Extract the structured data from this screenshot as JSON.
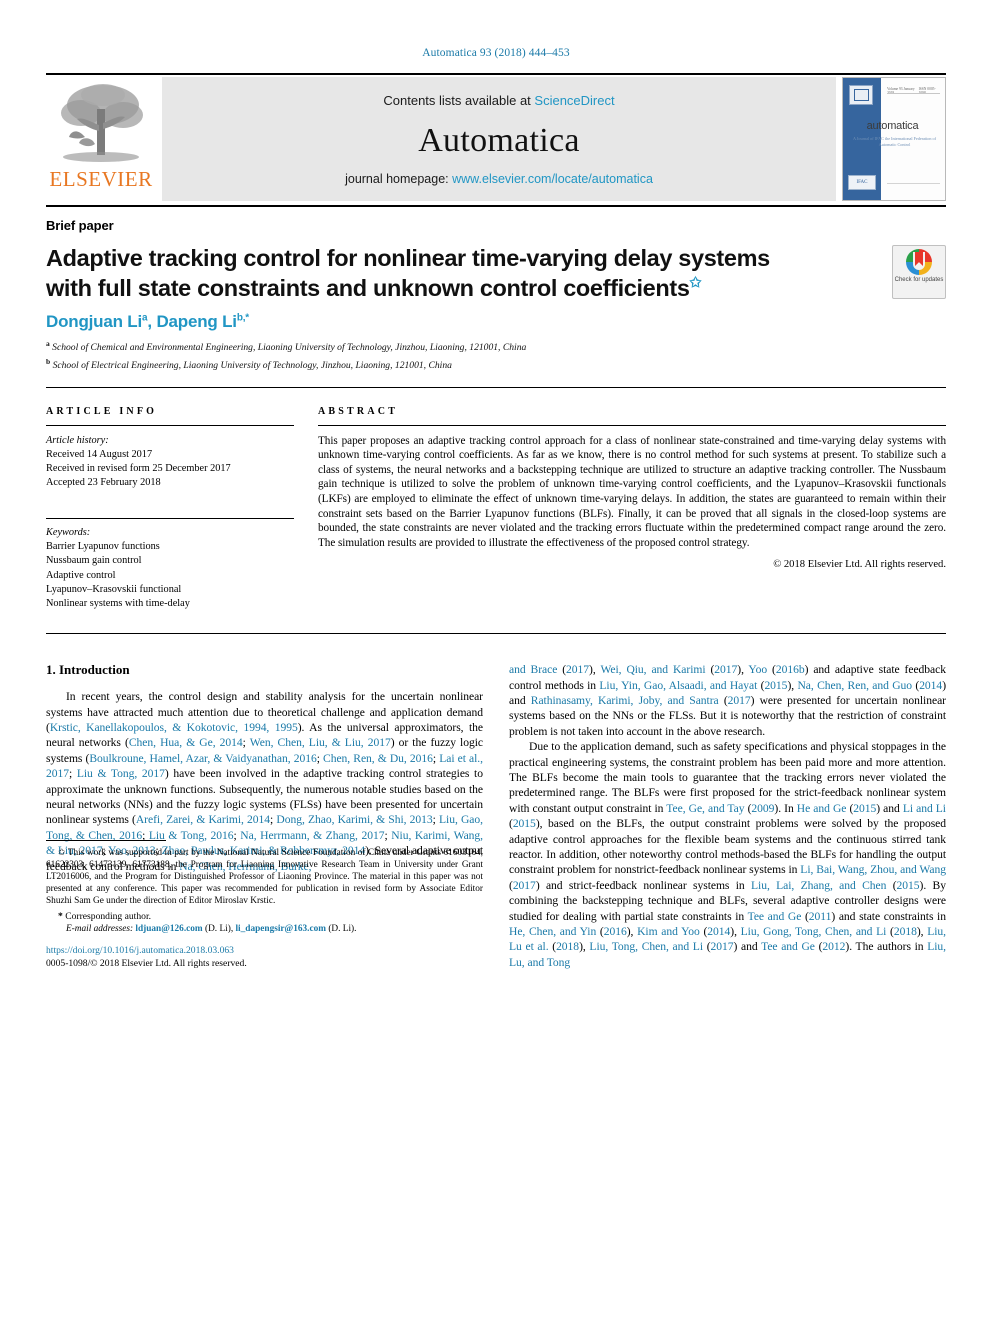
{
  "running_head": "Automatica 93 (2018) 444–453",
  "banner": {
    "contents_prefix": "Contents lists available at ",
    "contents_link": "ScienceDirect",
    "journal_name": "Automatica",
    "homepage_prefix": "journal homepage: ",
    "homepage_link": "www.elsevier.com/locate/automatica",
    "publisher": "ELSEVIER",
    "cover": {
      "title": "automatica",
      "subtitle": "A Journal of IFAC the International Federation of Automatic Control",
      "top_left": "Volume 93   January 2018",
      "top_right": "ISSN 0005-1098",
      "badge": "IFAC"
    }
  },
  "article": {
    "type": "Brief paper",
    "title_line1": "Adaptive tracking control for nonlinear time-varying delay systems",
    "title_line2": "with full state constraints and unknown control coefficients",
    "title_footnote_marker": "✩",
    "authors": "Dongjuan Li",
    "author_sup_a": "a",
    "author2": "Dapeng Li",
    "author_sup_b": "b,*",
    "affiliation_a_marker": "a",
    "affiliation_a": "School of Chemical and Environmental Engineering, Liaoning University of Technology, Jinzhou, Liaoning, 121001, China",
    "affiliation_b_marker": "b",
    "affiliation_b": "School of Electrical Engineering, Liaoning University of Technology, Jinzhou, Liaoning, 121001, China",
    "crossmark_label": "Check for updates"
  },
  "info": {
    "heading": "ARTICLE INFO",
    "history_label": "Article history:",
    "history": [
      "Received 14 August 2017",
      "Received in revised form 25 December 2017",
      "Accepted 23 February 2018"
    ],
    "keywords_label": "Keywords:",
    "keywords": [
      "Barrier Lyapunov functions",
      "Nussbaum gain control",
      "Adaptive control",
      "Lyapunov–Krasovskii functional",
      "Nonlinear systems with time-delay"
    ]
  },
  "abstract": {
    "heading": "ABSTRACT",
    "text": "This paper proposes an adaptive tracking control approach for a class of nonlinear state-constrained and time-varying delay systems with unknown time-varying control coefficients. As far as we know, there is no control method for such systems at present. To stabilize such a class of systems, the neural networks and a backstepping technique are utilized to structure an adaptive tracking controller. The Nussbaum gain technique is utilized to solve the problem of unknown time-varying control coefficients, and the Lyapunov–Krasovskii functionals (LKFs) are employed to eliminate the effect of unknown time-varying delays. In addition, the states are guaranteed to remain within their constraint sets based on the Barrier Lyapunov functions (BLFs). Finally, it can be proved that all signals in the closed-loop systems are bounded, the state constraints are never violated and the tracking errors fluctuate within the predetermined compact range around the zero. The simulation results are provided to illustrate the effectiveness of the proposed control strategy.",
    "copyright": "© 2018 Elsevier Ltd. All rights reserved."
  },
  "introduction": {
    "heading": "1. Introduction",
    "left_paragraph_1_parts": [
      {
        "t": "In recent years, the control design and stability analysis for  the uncertain nonlinear systems have attracted much attention due to theoretical challenge and application demand (",
        "r": false
      },
      {
        "t": "Krstic, Kanellakopoulos, & Kokotovic, 1994, 1995",
        "r": true
      },
      {
        "t": "). As the universal approximators, the neural networks (",
        "r": false
      },
      {
        "t": "Chen, Hua, & Ge, 2014",
        "r": true
      },
      {
        "t": "; ",
        "r": false
      },
      {
        "t": "Wen, Chen, Liu, & Liu, 2017",
        "r": true
      },
      {
        "t": ") or the fuzzy logic systems (",
        "r": false
      },
      {
        "t": "Boulkroune, Hamel, Azar, & Vaidyanathan, 2016",
        "r": true
      },
      {
        "t": "; ",
        "r": false
      },
      {
        "t": "Chen, Ren, & Du, 2016",
        "r": true
      },
      {
        "t": "; ",
        "r": false
      },
      {
        "t": "Lai et al., 2017",
        "r": true
      },
      {
        "t": "; ",
        "r": false
      },
      {
        "t": "Liu & Tong, 2017",
        "r": true
      },
      {
        "t": ") have been involved in the adaptive tracking control strategies to approximate the unknown functions. Subsequently, the numerous notable studies based on the neural networks (NNs) and the fuzzy logic systems (FLSs) have been presented for uncertain nonlinear systems (",
        "r": false
      },
      {
        "t": "Arefi, Zarei, & Karimi, 2014",
        "r": true
      },
      {
        "t": "; ",
        "r": false
      },
      {
        "t": "Dong, Zhao, Karimi, & Shi, 2013",
        "r": true
      },
      {
        "t": "; ",
        "r": false
      },
      {
        "t": "Liu, Gao, Tong, & Chen, 2016",
        "r": true
      },
      {
        "t": "; ",
        "r": false
      },
      {
        "t": "Liu & Tong, 2016",
        "r": true
      },
      {
        "t": "; ",
        "r": false
      },
      {
        "t": "Na, Herrmann, & Zhang, 2017",
        "r": true
      },
      {
        "t": "; ",
        "r": false
      },
      {
        "t": "Niu, Karimi, Wang, & Liu, 2017",
        "r": true
      },
      {
        "t": "; ",
        "r": false
      },
      {
        "t": "Yoo, 2013",
        "r": true
      },
      {
        "t": "; ",
        "r": false
      },
      {
        "t": "Zhao, Pawlus, Karimi, & Robbersmyr, 2014",
        "r": true
      },
      {
        "t": "). Several adaptive output feedback control methods in ",
        "r": false
      },
      {
        "t": "Na, Chen, Herrmann, Burke,",
        "r": true
      }
    ],
    "right_paragraph_1_parts": [
      {
        "t": "and Brace",
        "r": true
      },
      {
        "t": " (",
        "r": false
      },
      {
        "t": "2017",
        "r": true
      },
      {
        "t": "), ",
        "r": false
      },
      {
        "t": "Wei, Qiu, and Karimi",
        "r": true
      },
      {
        "t": " (",
        "r": false
      },
      {
        "t": "2017",
        "r": true
      },
      {
        "t": "), ",
        "r": false
      },
      {
        "t": "Yoo",
        "r": true
      },
      {
        "t": " (",
        "r": false
      },
      {
        "t": "2016b",
        "r": true
      },
      {
        "t": ") and adaptive state feedback control methods in ",
        "r": false
      },
      {
        "t": "Liu, Yin, Gao, Alsaadi, and Hayat",
        "r": true
      },
      {
        "t": " (",
        "r": false
      },
      {
        "t": "2015",
        "r": true
      },
      {
        "t": "), ",
        "r": false
      },
      {
        "t": "Na, Chen, Ren, and Guo",
        "r": true
      },
      {
        "t": " (",
        "r": false
      },
      {
        "t": "2014",
        "r": true
      },
      {
        "t": ") and ",
        "r": false
      },
      {
        "t": "Rathinasamy, Karimi, Joby, and Santra",
        "r": true
      },
      {
        "t": " (",
        "r": false
      },
      {
        "t": "2017",
        "r": true
      },
      {
        "t": ") were presented for uncertain nonlinear systems based on the NNs or the FLSs. But it is noteworthy that the restriction of constraint problem is not taken into account in the above research.",
        "r": false
      }
    ],
    "right_paragraph_2_parts": [
      {
        "t": "Due to the application demand, such as safety specifications and physical stoppages in the practical engineering systems, the constraint problem has been paid more and more attention. The BLFs become the main tools to guarantee that the tracking errors never violated the predetermined range. The BLFs were first proposed for the strict-feedback nonlinear system with constant output constraint in ",
        "r": false
      },
      {
        "t": "Tee, Ge, and Tay",
        "r": true
      },
      {
        "t": " (",
        "r": false
      },
      {
        "t": "2009",
        "r": true
      },
      {
        "t": "). In ",
        "r": false
      },
      {
        "t": "He and Ge",
        "r": true
      },
      {
        "t": " (",
        "r": false
      },
      {
        "t": "2015",
        "r": true
      },
      {
        "t": ") and ",
        "r": false
      },
      {
        "t": "Li and Li",
        "r": true
      },
      {
        "t": " (",
        "r": false
      },
      {
        "t": "2015",
        "r": true
      },
      {
        "t": "), based on the BLFs, the output constraint problems were solved by the proposed adaptive control approaches for the flexible beam systems and the continuous stirred tank reactor. In addition, other noteworthy control methods-based the BLFs for handling the output constraint problem for nonstrict-feedback nonlinear systems in ",
        "r": false
      },
      {
        "t": "Li, Bai, Wang, Zhou, and Wang",
        "r": true
      },
      {
        "t": " (",
        "r": false
      },
      {
        "t": "2017",
        "r": true
      },
      {
        "t": ") and strict-feedback nonlinear systems in ",
        "r": false
      },
      {
        "t": "Liu, Lai, Zhang, and Chen",
        "r": true
      },
      {
        "t": " (",
        "r": false
      },
      {
        "t": "2015",
        "r": true
      },
      {
        "t": "). By combining the backstepping technique and BLFs, several adaptive controller designs were studied for dealing with partial state constraints in ",
        "r": false
      },
      {
        "t": "Tee and Ge",
        "r": true
      },
      {
        "t": " (",
        "r": false
      },
      {
        "t": "2011",
        "r": true
      },
      {
        "t": ") and state constraints in ",
        "r": false
      },
      {
        "t": "He, Chen, and Yin",
        "r": true
      },
      {
        "t": " (",
        "r": false
      },
      {
        "t": "2016",
        "r": true
      },
      {
        "t": "), ",
        "r": false
      },
      {
        "t": "Kim and Yoo",
        "r": true
      },
      {
        "t": " (",
        "r": false
      },
      {
        "t": "2014",
        "r": true
      },
      {
        "t": "), ",
        "r": false
      },
      {
        "t": "Liu, Gong, Tong, Chen, and Li",
        "r": true
      },
      {
        "t": " (",
        "r": false
      },
      {
        "t": "2018",
        "r": true
      },
      {
        "t": "), ",
        "r": false
      },
      {
        "t": "Liu, Lu et al.",
        "r": true
      },
      {
        "t": " (",
        "r": false
      },
      {
        "t": "2018",
        "r": true
      },
      {
        "t": "), ",
        "r": false
      },
      {
        "t": "Liu, Tong, Chen, and Li",
        "r": true
      },
      {
        "t": " (",
        "r": false
      },
      {
        "t": "2017",
        "r": true
      },
      {
        "t": ") and ",
        "r": false
      },
      {
        "t": "Tee and Ge",
        "r": true
      },
      {
        "t": " (",
        "r": false
      },
      {
        "t": "2012",
        "r": true
      },
      {
        "t": "). The authors in ",
        "r": false
      },
      {
        "t": "Liu, Lu, and Tong",
        "r": true
      }
    ]
  },
  "footnotes": {
    "star_marker": "✩",
    "funding": "This work was supported in part by the National Natural Science Foundation of China under Grants 61603164, 61622303, 61473139, 61773188, the Program for Liaoning Innovative Research Team in University under Grant LT2016006, and the Program for Distinguished Professor of Liaoning Province. The material in this paper was not presented at any conference. This paper was recommended for publication in revised form by Associate Editor Shuzhi Sam Ge under the direction of Editor Miroslav Krstic.",
    "corresponding_marker": "*",
    "corresponding": "Corresponding author.",
    "email_label": "E-mail addresses:",
    "email1": "ldjuan@126.com",
    "email1_who": "(D. Li),",
    "email2": "li_dapengsir@163.com",
    "email2_who": "(D. Li).",
    "doi": "https://doi.org/10.1016/j.automatica.2018.03.063",
    "issn_line": "0005-1098/© 2018 Elsevier Ltd. All rights reserved."
  },
  "colors": {
    "link": "#1b7aa8",
    "banner_bg": "#e7e7e7",
    "elsevier_orange": "#E87722",
    "cover_blue": "#36659e"
  }
}
